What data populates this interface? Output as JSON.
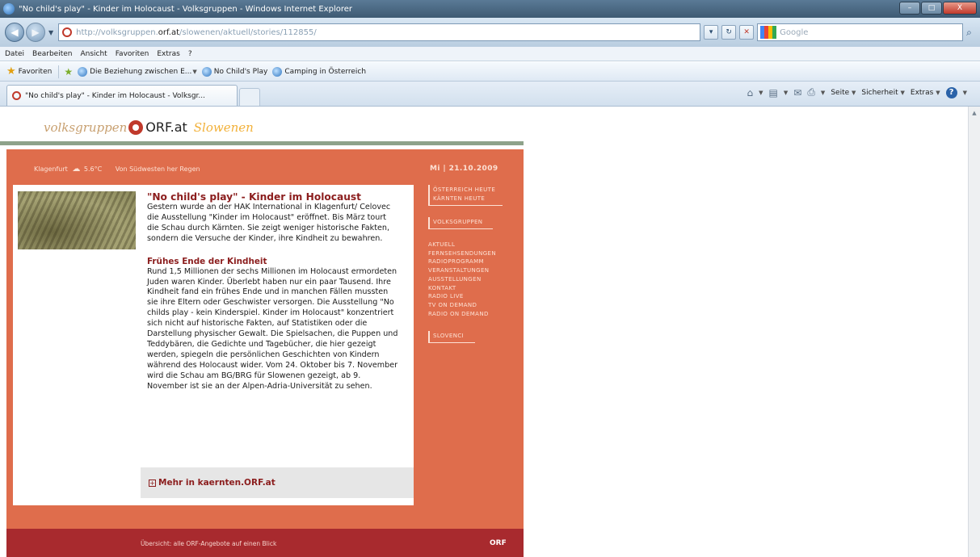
{
  "window": {
    "title": "\"No child's play\" - Kinder im Holocaust - Volksgruppen - Windows Internet Explorer",
    "buttons": {
      "minimize": "–",
      "maximize": "□",
      "close": "X"
    }
  },
  "nav": {
    "back": "◀",
    "forward": "▶",
    "url_prefix": "http://volksgruppen.",
    "url_domain": "orf.at",
    "url_path": "/slowenen/aktuell/stories/112855/",
    "search_placeholder": "Google"
  },
  "menu": [
    "Datei",
    "Bearbeiten",
    "Ansicht",
    "Favoriten",
    "Extras",
    "?"
  ],
  "favorites": {
    "label": "Favoriten",
    "links": [
      "Die Beziehung zwischen E...",
      "No Child's Play",
      "Camping in Österreich"
    ]
  },
  "tab": {
    "label": "\"No child's play\" - Kinder im Holocaust - Volksgr..."
  },
  "commandbar": {
    "page": "Seite",
    "security": "Sicherheit",
    "tools": "Extras"
  },
  "site": {
    "brand_left": "volksgruppen",
    "brand_orf": "ORF.at",
    "brand_region": "Slowenen",
    "weather_city": "Klagenfurt",
    "weather_temp": "5.6°C",
    "weather_forecast": "Von Südwesten her Regen",
    "date": "Mi | 21.10.2009"
  },
  "article": {
    "title": "\"No child's play\" - Kinder im Holocaust",
    "lead": "Gestern wurde an der HAK International in Klagenfurt/ Celovec die Ausstellung \"Kinder im Holocaust\" eröffnet. Bis März tourt die Schau durch Kärnten. Sie zeigt weniger historische Fakten, sondern die Versuche der Kinder, ihre Kindheit zu bewahren.",
    "subheading": "Frühes Ende der Kindheit",
    "body": "Rund 1,5 Millionen der sechs Millionen im Holocaust ermordeten Juden waren Kinder. Überlebt haben nur ein paar Tausend. Ihre Kindheit fand ein frühes Ende und in manchen Fällen mussten sie ihre Eltern oder Geschwister versorgen. Die Ausstellung \"No childs play - kein Kinderspiel. Kinder im Holocaust\" konzentriert sich nicht auf historische Fakten, auf Statistiken oder die Darstellung physischer Gewalt. Die Spielsachen, die Puppen und Teddybären, die Gedichte und Tagebücher, die hier gezeigt werden, spiegeln die persönlichen Geschichten von Kindern während des Holocaust wider. Vom 24. Oktober bis 7. November wird die Schau am BG/BRG für Slowenen gezeigt, ab 9. November ist sie an der Alpen-Adria-Universität zu sehen.",
    "more_link": "Mehr in kaernten.ORF.at"
  },
  "sidenav": {
    "box1": "ÖSTERREICH HEUTE KÄRNTEN HEUTE",
    "box2": "VOLKSGRUPPEN",
    "items": [
      "AKTUELL",
      "FERNSEHSENDUNGEN",
      "RADIOPROGRAMM",
      "VERANSTALTUNGEN",
      "AUSSTELLUNGEN",
      "KONTAKT",
      "RADIO LIVE",
      "TV ON DEMAND",
      "RADIO ON DEMAND"
    ],
    "box3": "SLOVENCI"
  },
  "footer": {
    "text": "Übersicht: alle ORF-Angebote auf einen Blick",
    "logo": "ORF"
  }
}
